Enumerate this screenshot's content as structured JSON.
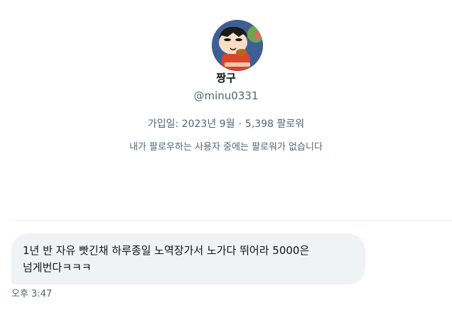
{
  "profile": {
    "display_name": "짱구",
    "handle": "@minu0331",
    "joined": "가입일: 2023년 9월",
    "separator": "·",
    "followers": "5,398 팔로워",
    "mutual_note": "내가 팔로우하는 사용자 중에는 팔로워가 없습니다"
  },
  "message": {
    "text": "1년 반 자유 빳긴채 하루종일 노역장가서 노가다 뛰어라 5000은 넘게번다ㅋㅋㅋ",
    "time": "오후 3:47"
  }
}
